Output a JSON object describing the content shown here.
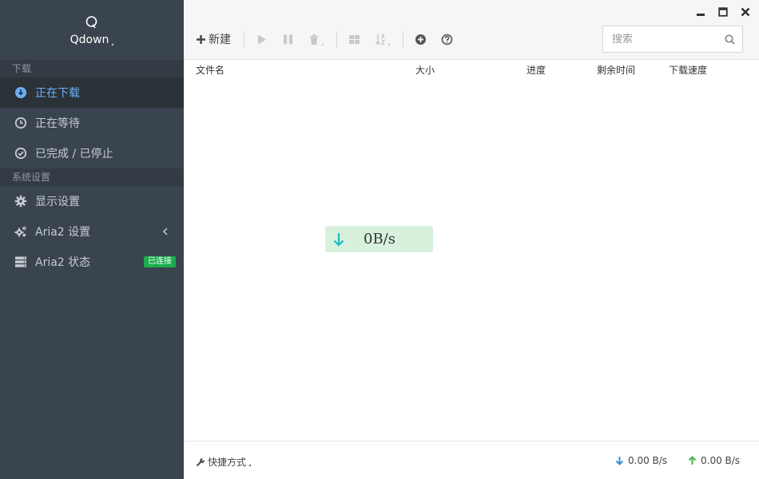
{
  "app": {
    "name": "Qdown"
  },
  "sidebar": {
    "sections": [
      {
        "title": "下载"
      },
      {
        "title": "系统设置"
      }
    ],
    "items": [
      {
        "label": "正在下载"
      },
      {
        "label": "正在等待"
      },
      {
        "label": "已完成 / 已停止"
      },
      {
        "label": "显示设置"
      },
      {
        "label": "Aria2 设置"
      },
      {
        "label": "Aria2 状态",
        "badge": "已连接"
      }
    ]
  },
  "toolbar": {
    "new_label": "新建"
  },
  "search": {
    "placeholder": "搜索"
  },
  "table": {
    "columns": [
      "文件名",
      "大小",
      "进度",
      "剩余时间",
      "下载速度"
    ]
  },
  "speed_widget": {
    "value": "0B/s"
  },
  "footer": {
    "shortcut_label": "快捷方式",
    "download_speed": "0.00 B/s",
    "upload_speed": "0.00 B/s"
  },
  "colors": {
    "sidebar_bg": "#3a444e",
    "active_text": "#6ab0f5",
    "badge_green": "#1aad4d",
    "download_arrow": "#3a8fd6",
    "upload_arrow": "#4caf50",
    "speed_box_bg": "#d8f1dc",
    "speed_arrow": "#20b8c8"
  },
  "icons": {
    "logo": "search-q-icon",
    "downloading": "download-circle-icon",
    "waiting": "clock-icon",
    "completed": "check-circle-icon",
    "display_settings": "gear-icon",
    "aria2_settings": "gears-icon",
    "aria2_status": "server-icon"
  }
}
